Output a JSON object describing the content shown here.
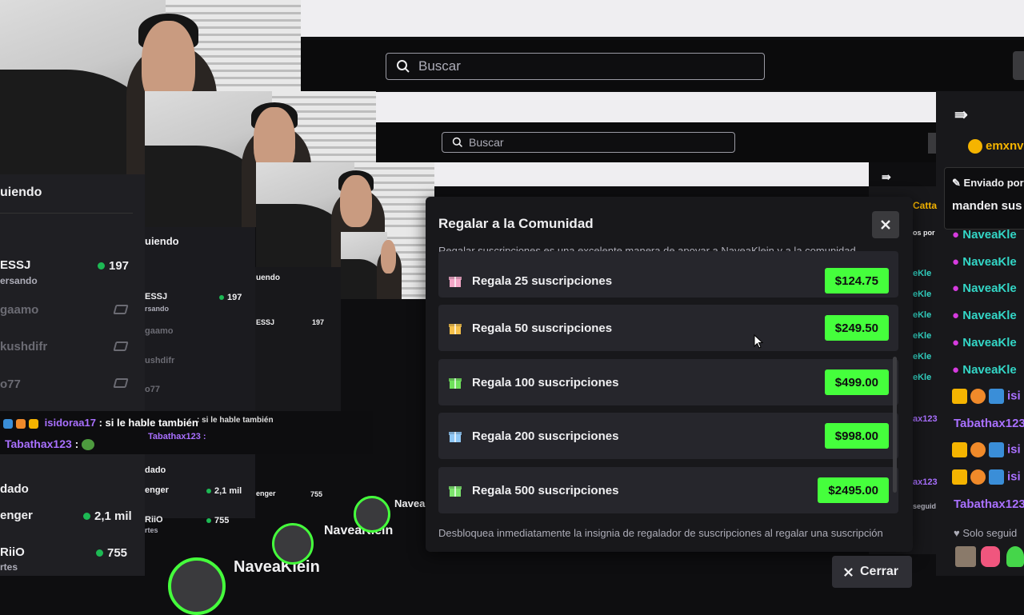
{
  "search": {
    "placeholder_1": "Buscar",
    "placeholder_2": "Buscar"
  },
  "sidebar": {
    "header": "uiendo",
    "header_2": "uiendo",
    "header_3": "uendo",
    "items": [
      {
        "name": "ESSJ",
        "sub": "ersando",
        "viewers": "197"
      },
      {
        "name": "gaamo"
      },
      {
        "name": "kushdifr"
      },
      {
        "name": "o77"
      },
      {
        "name": "dado"
      },
      {
        "name": "enger",
        "viewers": "2,1 mil"
      },
      {
        "name": "RiiO",
        "sub": "rtes",
        "viewers": "755"
      }
    ],
    "small_items": [
      {
        "name": "ESSJ",
        "sub": "rsando",
        "viewers": "197"
      },
      {
        "name": "gaamo"
      },
      {
        "name": "ushdifr"
      },
      {
        "name": "o77"
      },
      {
        "name": "dado"
      },
      {
        "name": "enger",
        "viewers": "2,1 mil"
      },
      {
        "name": "RiiO",
        "sub": "rtes",
        "viewers": "755"
      }
    ]
  },
  "chat_overlay": {
    "line1_user": "isidoraa17",
    "line1_text": ": si le hable también",
    "line2_user": "Tabathax123",
    "line2_text": ":",
    "small_line1": ": si le hable también",
    "small_line2": "Tabathax123 :"
  },
  "channel": {
    "name_1": "NaveaKlein",
    "name_2": "NaveaKlein",
    "name_3": "Navea"
  },
  "right_chat": {
    "top_user": "emxnv",
    "pinned_label": "Enviado por",
    "pinned_text": "manden sus",
    "users": [
      "NaveaKle",
      "NaveaKle",
      "NaveaKle",
      "NaveaKle",
      "NaveaKle",
      "NaveaKle"
    ],
    "isi_1": "isi",
    "tab_1": "Tabathax123",
    "isi_2": "isi",
    "isi_3": "isi",
    "tab_2": "Tabathax123",
    "followers": "Solo seguid",
    "mid_col": [
      "Catta",
      "os por",
      "s",
      "eKle",
      "eKle",
      "eKle",
      "eKle",
      "eKle",
      "eKle",
      "ax123",
      "ax123",
      "seguid"
    ]
  },
  "modal": {
    "title": "Regalar a la Comunidad",
    "description": "Regalar suscripciones es una excelente manera de apoyar a NaveaKlein y a la comunidad.",
    "options": [
      {
        "label": "Regala 25 suscripciones",
        "price": "$124.75",
        "color": "#f4a7c8"
      },
      {
        "label": "Regala 50 suscripciones",
        "price": "$249.50",
        "color": "#f5c04a"
      },
      {
        "label": "Regala 100 suscripciones",
        "price": "$499.00",
        "color": "#6ee05b"
      },
      {
        "label": "Regala 200 suscripciones",
        "price": "$998.00",
        "color": "#8fc7f5"
      },
      {
        "label": "Regala 500 suscripciones",
        "price": "$2495.00",
        "color": "#7be36c"
      }
    ],
    "footer": "Desbloquea inmediatamente la insignia de regalador de suscripciones al regalar una suscripción",
    "close_label": "Cerrar"
  },
  "colors": {
    "accent": "#45ff3c",
    "live": "#1db954",
    "purple": "#a970ff"
  },
  "icons": [
    "search-icon",
    "close-icon",
    "gift-icon",
    "collapse-icon",
    "mic-icon",
    "crown-icon",
    "pin-icon",
    "heart-icon"
  ]
}
